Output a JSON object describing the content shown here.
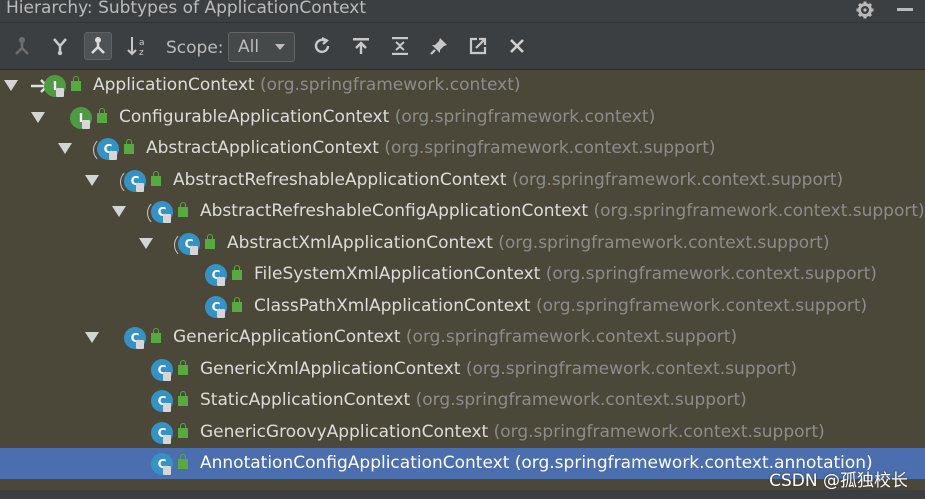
{
  "window": {
    "title": "Hierarchy:  Subtypes of ApplicationContext"
  },
  "toolbar": {
    "buttons": [
      {
        "name": "supertypes-hierarchy-button",
        "icon": "supertypes-icon"
      },
      {
        "name": "subtypes-hierarchy-button",
        "icon": "subtypes-icon"
      },
      {
        "name": "class-hierarchy-button",
        "icon": "class-hierarchy-icon",
        "active": true
      },
      {
        "name": "sort-alphabetically-button",
        "icon": "sort-alpha-icon"
      }
    ],
    "scope_label": "Scope:",
    "scope_value": "All",
    "actions": [
      {
        "name": "refresh-button",
        "icon": "refresh-icon"
      },
      {
        "name": "scroll-to-source-button",
        "icon": "scroll-to-source-icon"
      },
      {
        "name": "expand-all-button",
        "icon": "expand-all-icon"
      },
      {
        "name": "pin-button",
        "icon": "pin-icon"
      },
      {
        "name": "export-button",
        "icon": "export-icon"
      },
      {
        "name": "close-button",
        "icon": "close-icon"
      }
    ]
  },
  "tree": {
    "rows": [
      {
        "depth": 0,
        "expanded": true,
        "kind": "interface",
        "marker": "arrow",
        "name": "ApplicationContext",
        "pkg": "(org.springframework.context)"
      },
      {
        "depth": 1,
        "expanded": true,
        "kind": "interface",
        "name": "ConfigurableApplicationContext",
        "pkg": "(org.springframework.context)"
      },
      {
        "depth": 2,
        "expanded": true,
        "kind": "abstract",
        "name": "AbstractApplicationContext",
        "pkg": "(org.springframework.context.support)"
      },
      {
        "depth": 3,
        "expanded": true,
        "kind": "abstract",
        "name": "AbstractRefreshableApplicationContext",
        "pkg": "(org.springframework.context.support)"
      },
      {
        "depth": 4,
        "expanded": true,
        "kind": "abstract",
        "name": "AbstractRefreshableConfigApplicationContext",
        "pkg": "(org.springframework.context.support)"
      },
      {
        "depth": 5,
        "expanded": true,
        "kind": "abstract",
        "name": "AbstractXmlApplicationContext",
        "pkg": "(org.springframework.context.support)"
      },
      {
        "depth": 6,
        "expanded": false,
        "leaf": true,
        "kind": "class",
        "name": "FileSystemXmlApplicationContext",
        "pkg": "(org.springframework.context.support)"
      },
      {
        "depth": 6,
        "expanded": false,
        "leaf": true,
        "kind": "class",
        "name": "ClassPathXmlApplicationContext",
        "pkg": "(org.springframework.context.support)"
      },
      {
        "depth": 3,
        "expanded": true,
        "kind": "class",
        "name": "GenericApplicationContext",
        "pkg": "(org.springframework.context.support)"
      },
      {
        "depth": 4,
        "expanded": false,
        "leaf": true,
        "kind": "class",
        "name": "GenericXmlApplicationContext",
        "pkg": "(org.springframework.context.support)"
      },
      {
        "depth": 4,
        "expanded": false,
        "leaf": true,
        "kind": "class",
        "name": "StaticApplicationContext",
        "pkg": "(org.springframework.context.support)"
      },
      {
        "depth": 4,
        "expanded": false,
        "leaf": true,
        "kind": "class",
        "name": "GenericGroovyApplicationContext",
        "pkg": "(org.springframework.context.support)"
      },
      {
        "depth": 4,
        "expanded": false,
        "leaf": true,
        "kind": "class",
        "name": "AnnotationConfigApplicationContext",
        "pkg": "(org.springframework.context.annotation)",
        "selected": true
      }
    ]
  },
  "watermark": "CSDN @孤独校长",
  "colors": {
    "background": "#3c3f41",
    "tree_bg": "#4b483a",
    "selection": "#4b6eaf",
    "class_icon": "#3592c4",
    "interface_icon": "#4f9b43",
    "package_text": "#8c8c8c"
  }
}
